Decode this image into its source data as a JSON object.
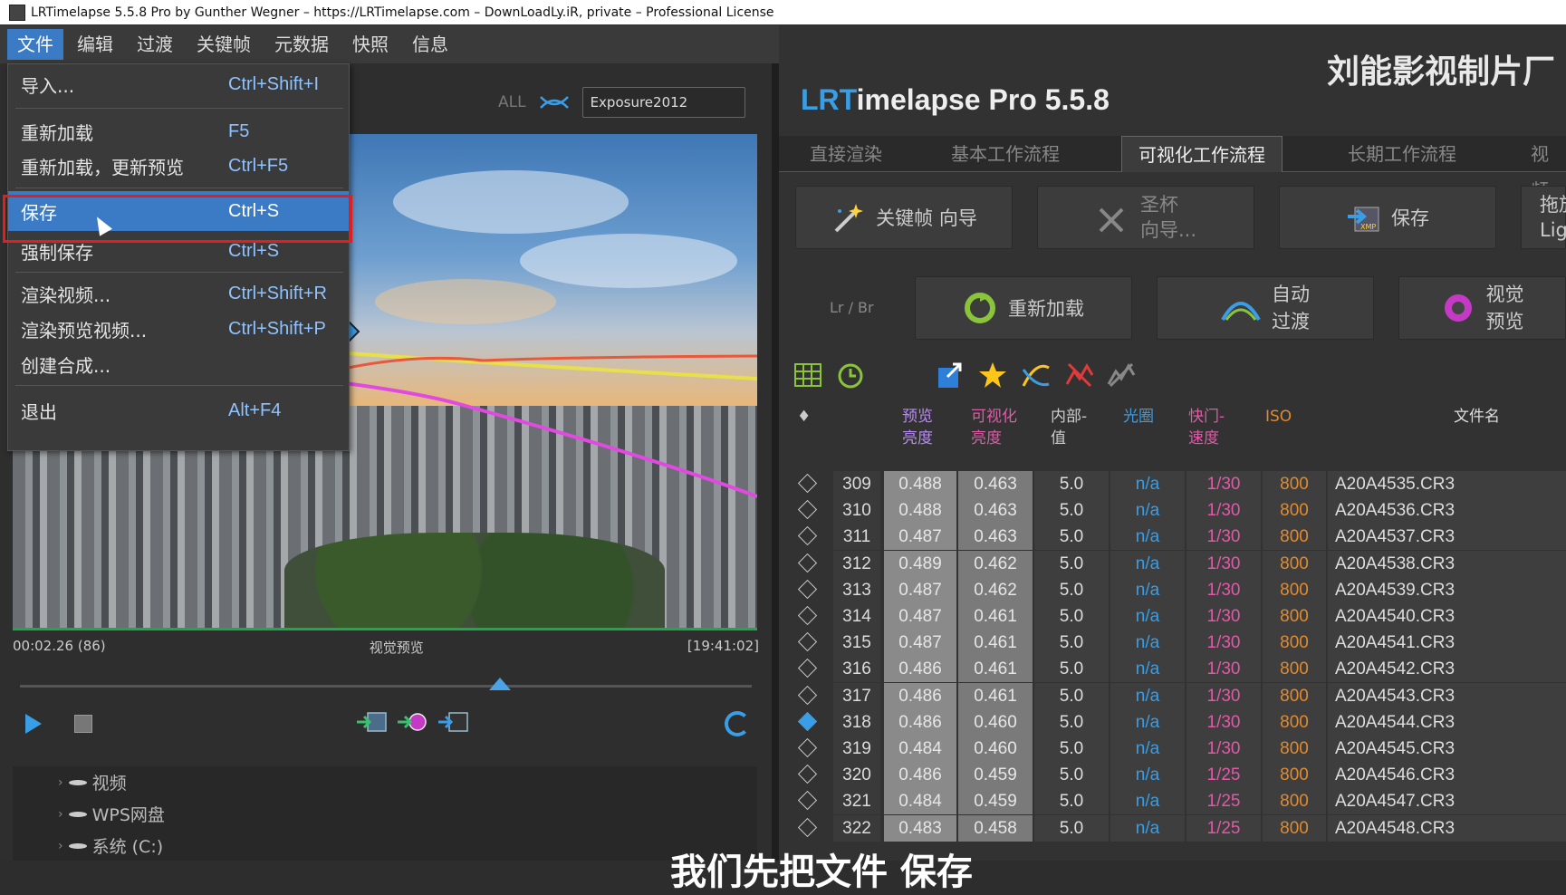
{
  "window_title": "LRTimelapse 5.5.8 Pro by Gunther Wegner – https://LRTimelapse.com – DownLoadLy.iR, private – Professional License",
  "menubar": [
    "文件",
    "编辑",
    "过渡",
    "关键帧",
    "元数据",
    "快照",
    "信息"
  ],
  "file_menu": [
    {
      "label": "导入...",
      "shortcut": "Ctrl+Shift+I"
    },
    {
      "label": "重新加载",
      "shortcut": "F5"
    },
    {
      "label": "重新加载，更新预览",
      "shortcut": "Ctrl+F5"
    },
    {
      "label": "保存",
      "shortcut": "Ctrl+S"
    },
    {
      "label": "强制保存",
      "shortcut": "Ctrl+S"
    },
    {
      "label": "渲染视频...",
      "shortcut": "Ctrl+Shift+R"
    },
    {
      "label": "渲染预览视频...",
      "shortcut": "Ctrl+Shift+P"
    },
    {
      "label": "创建合成...",
      "shortcut": ""
    },
    {
      "label": "退出",
      "shortcut": "Alt+F4"
    }
  ],
  "filter": {
    "all_label": "ALL",
    "value": "Exposure2012"
  },
  "preview": {
    "time": "00:02.26 (86)",
    "label": "视觉预览",
    "duration": "[19:41:02]"
  },
  "tree": [
    "视频",
    "WPS网盘",
    "系统 (C:)"
  ],
  "watermark": "刘能影视制片厂",
  "app_title": {
    "prefix": "LRT",
    "rest": "imelapse Pro 5.5.8"
  },
  "tabs": [
    "直接渲染",
    "基本工作流程",
    "可视化工作流程",
    "长期工作流程",
    "视频"
  ],
  "workflow_row1": [
    {
      "label": "关键帧 向导"
    },
    {
      "label": "圣杯\n向导..."
    },
    {
      "label": "保存"
    },
    {
      "label": "拖放\nLigh"
    }
  ],
  "lr_br": "Lr / Br",
  "workflow_row2": [
    {
      "label": "重新加载"
    },
    {
      "label": "自动\n过渡"
    },
    {
      "label": "视觉\n预览"
    }
  ],
  "table_headers": {
    "key": "♦",
    "preview_brightness": "预览\n亮度",
    "visual_brightness": "可视化\n亮度",
    "internal": "内部-\n值",
    "aperture": "光圈",
    "shutter": "快门-\n速度",
    "iso": "ISO",
    "filename": "文件名"
  },
  "rows": [
    {
      "n": "309",
      "pb": "0.488",
      "vb": "0.463",
      "iv": "5.0",
      "ap": "n/a",
      "sh": "1/30",
      "iso": "800",
      "fn": "A20A4535.CR3",
      "key": false
    },
    {
      "n": "310",
      "pb": "0.488",
      "vb": "0.463",
      "iv": "5.0",
      "ap": "n/a",
      "sh": "1/30",
      "iso": "800",
      "fn": "A20A4536.CR3",
      "key": false
    },
    {
      "n": "311",
      "pb": "0.487",
      "vb": "0.463",
      "iv": "5.0",
      "ap": "n/a",
      "sh": "1/30",
      "iso": "800",
      "fn": "A20A4537.CR3",
      "key": false
    },
    {
      "n": "312",
      "pb": "0.489",
      "vb": "0.462",
      "iv": "5.0",
      "ap": "n/a",
      "sh": "1/30",
      "iso": "800",
      "fn": "A20A4538.CR3",
      "key": false
    },
    {
      "n": "313",
      "pb": "0.487",
      "vb": "0.462",
      "iv": "5.0",
      "ap": "n/a",
      "sh": "1/30",
      "iso": "800",
      "fn": "A20A4539.CR3",
      "key": false
    },
    {
      "n": "314",
      "pb": "0.487",
      "vb": "0.461",
      "iv": "5.0",
      "ap": "n/a",
      "sh": "1/30",
      "iso": "800",
      "fn": "A20A4540.CR3",
      "key": false
    },
    {
      "n": "315",
      "pb": "0.487",
      "vb": "0.461",
      "iv": "5.0",
      "ap": "n/a",
      "sh": "1/30",
      "iso": "800",
      "fn": "A20A4541.CR3",
      "key": false
    },
    {
      "n": "316",
      "pb": "0.486",
      "vb": "0.461",
      "iv": "5.0",
      "ap": "n/a",
      "sh": "1/30",
      "iso": "800",
      "fn": "A20A4542.CR3",
      "key": false
    },
    {
      "n": "317",
      "pb": "0.486",
      "vb": "0.461",
      "iv": "5.0",
      "ap": "n/a",
      "sh": "1/30",
      "iso": "800",
      "fn": "A20A4543.CR3",
      "key": false
    },
    {
      "n": "318",
      "pb": "0.486",
      "vb": "0.460",
      "iv": "5.0",
      "ap": "n/a",
      "sh": "1/30",
      "iso": "800",
      "fn": "A20A4544.CR3",
      "key": true
    },
    {
      "n": "319",
      "pb": "0.484",
      "vb": "0.460",
      "iv": "5.0",
      "ap": "n/a",
      "sh": "1/30",
      "iso": "800",
      "fn": "A20A4545.CR3",
      "key": false
    },
    {
      "n": "320",
      "pb": "0.486",
      "vb": "0.459",
      "iv": "5.0",
      "ap": "n/a",
      "sh": "1/25",
      "iso": "800",
      "fn": "A20A4546.CR3",
      "key": false
    },
    {
      "n": "321",
      "pb": "0.484",
      "vb": "0.459",
      "iv": "5.0",
      "ap": "n/a",
      "sh": "1/25",
      "iso": "800",
      "fn": "A20A4547.CR3",
      "key": false
    },
    {
      "n": "322",
      "pb": "0.483",
      "vb": "0.458",
      "iv": "5.0",
      "ap": "n/a",
      "sh": "1/25",
      "iso": "800",
      "fn": "A20A4548.CR3",
      "key": false
    }
  ],
  "subtitle": "我们先把文件  保存"
}
